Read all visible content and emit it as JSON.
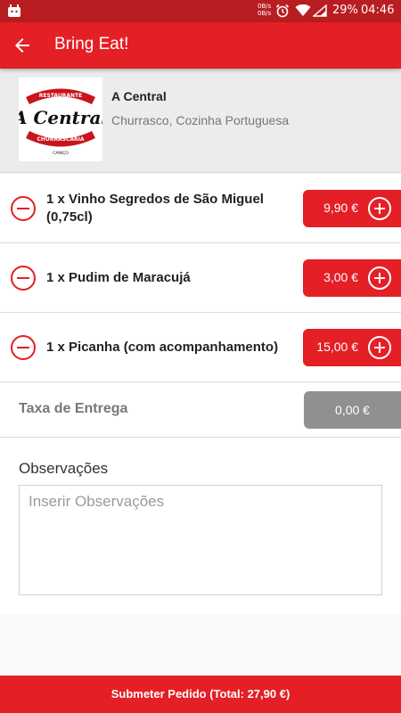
{
  "status_bar": {
    "net_up": "0B/s",
    "net_down": "0B/s",
    "battery": "29%",
    "time": "04:46"
  },
  "toolbar": {
    "title": "Bring Eat!",
    "back_icon": "arrow-left-icon"
  },
  "restaurant": {
    "name": "A Central",
    "cuisine": "Churrasco, Cozinha Portuguesa",
    "logo": {
      "top_text": "RESTAURANTE",
      "main_text": "A Central",
      "bottom_text": "CHURRASCARIA",
      "place": "CANIÇO"
    }
  },
  "items": [
    {
      "label": "1 x Vinho Segredos de São Miguel (0,75cl)",
      "price": "9,90 €"
    },
    {
      "label": "1 x Pudim de Maracujá",
      "price": "3,00 €"
    },
    {
      "label": "1 x Picanha (com acompanhamento)",
      "price": "15,00 €"
    }
  ],
  "delivery_fee": {
    "label": "Taxa de Entrega",
    "value": "0,00 €"
  },
  "observations": {
    "heading": "Observações",
    "placeholder": "Inserir Observações",
    "value": ""
  },
  "submit": {
    "label": "Submeter Pedido (Total: 27,90 €)"
  },
  "colors": {
    "primary": "#e41f26",
    "status_bar": "#b81d21",
    "fee_box": "#909090"
  }
}
